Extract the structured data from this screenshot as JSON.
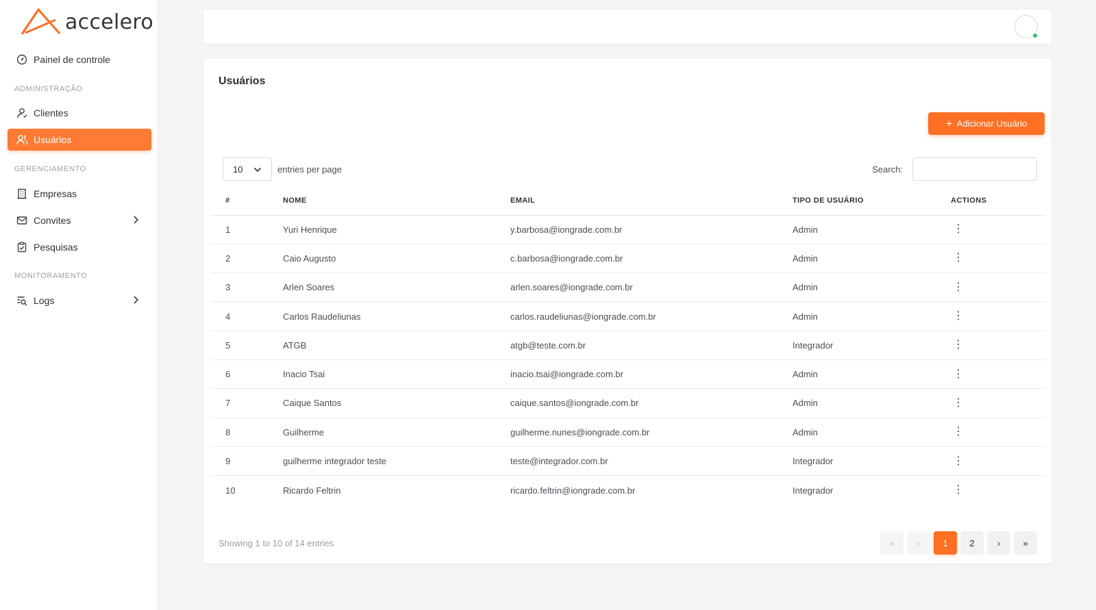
{
  "brand": {
    "name": "accelero",
    "accent": "#ff6f24"
  },
  "sidebar": {
    "dashboard": {
      "label": "Painel de controle",
      "icon": "gauge-icon"
    },
    "sections": [
      {
        "label": "ADMINISTRAÇÃO"
      },
      {
        "label": "GERENCIAMENTO"
      },
      {
        "label": "MONITORAMENTO"
      }
    ],
    "items": [
      {
        "label": "Clientes",
        "icon": "user-icon"
      },
      {
        "label": "Usuários",
        "icon": "users-icon",
        "active": true
      },
      {
        "label": "Empresas",
        "icon": "building-icon"
      },
      {
        "label": "Convites",
        "icon": "mail-icon",
        "expandable": true
      },
      {
        "label": "Pesquisas",
        "icon": "clipboard-check-icon"
      },
      {
        "label": "Logs",
        "icon": "log-search-icon",
        "expandable": true
      }
    ]
  },
  "topbar": {
    "avatar_status": "online"
  },
  "page": {
    "title": "Usuários",
    "add_button": "Adicionar Usuário",
    "entries_value": "10",
    "entries_label": "entries per page",
    "search_label": "Search:",
    "search_value": "",
    "columns": [
      "#",
      "NOME",
      "EMAIL",
      "TIPO DE USUÁRIO",
      "ACTIONS"
    ],
    "rows": [
      {
        "id": "1",
        "name": "Yuri Henrique",
        "email": "y.barbosa@iongrade.com.br",
        "type": "Admin"
      },
      {
        "id": "2",
        "name": "Caio Augusto",
        "email": "c.barbosa@iongrade.com.br",
        "type": "Admin"
      },
      {
        "id": "3",
        "name": "Arlen Soares",
        "email": "arlen.soares@iongrade.com.br",
        "type": "Admin"
      },
      {
        "id": "4",
        "name": "Carlos Raudeliunas",
        "email": "carlos.raudeliunas@iongrade.com.br",
        "type": "Admin"
      },
      {
        "id": "5",
        "name": "ATGB",
        "email": "atgb@teste.com.br",
        "type": "Integrador"
      },
      {
        "id": "6",
        "name": "Inacio Tsai",
        "email": "inacio.tsai@iongrade.com.br",
        "type": "Admin"
      },
      {
        "id": "7",
        "name": "Caique Santos",
        "email": "caique.santos@iongrade.com.br",
        "type": "Admin"
      },
      {
        "id": "8",
        "name": "Guilherme",
        "email": "guilherme.nunes@iongrade.com.br",
        "type": "Admin"
      },
      {
        "id": "9",
        "name": "guilherme integrador teste",
        "email": "teste@integrador.com.br",
        "type": "Integrador"
      },
      {
        "id": "10",
        "name": "Ricardo Feltrin",
        "email": "ricardo.feltrin@iongrade.com.br",
        "type": "Integrador"
      }
    ],
    "showing": "Showing 1 to 10 of 14 entries",
    "pagination": {
      "first": "«",
      "prev": "‹",
      "pages": [
        "1",
        "2"
      ],
      "current": "1",
      "next": "›",
      "last": "»"
    }
  }
}
